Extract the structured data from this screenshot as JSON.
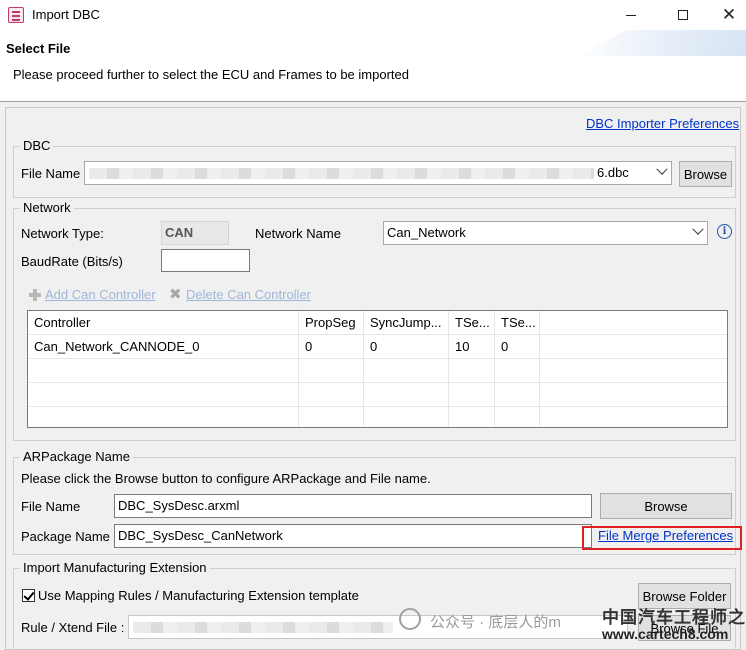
{
  "window": {
    "title": "Import DBC",
    "close_glyph": "✕"
  },
  "header": {
    "title": "Select File",
    "description": "Please proceed further to select the ECU and Frames to be imported"
  },
  "links": {
    "dbc_importer_preferences": "DBC Importer Preferences",
    "file_merge_preferences": "File Merge Preferences"
  },
  "dbc": {
    "legend": "DBC",
    "file_name_label": "File Name",
    "file_name_visible_suffix": "6.dbc",
    "browse_label": "Browse"
  },
  "network": {
    "legend": "Network",
    "type_label": "Network Type:",
    "type_value": "CAN",
    "name_label": "Network Name",
    "name_value": "Can_Network",
    "baudrate_label": "BaudRate (Bits/s)",
    "baudrate_value": "",
    "add_controller": "Add Can Controller",
    "delete_controller": "Delete Can Controller",
    "info_glyph": "i",
    "table": {
      "columns": [
        "Controller",
        "PropSeg",
        "SyncJump...",
        "TSe...",
        "TSe..."
      ],
      "rows": [
        [
          "Can_Network_CANNODE_0",
          "0",
          "0",
          "10",
          "0"
        ]
      ]
    }
  },
  "arpackage": {
    "legend": "ARPackage Name",
    "instruction": "Please click the Browse button to configure ARPackage and File name.",
    "file_name_label": "File Name",
    "file_name_value": "DBC_SysDesc.arxml",
    "browse_label": "Browse",
    "package_name_label": "Package Name",
    "package_name_value": "DBC_SysDesc_CanNetwork"
  },
  "manufacturing": {
    "legend": "Import Manufacturing Extension",
    "checkbox_label": "Use Mapping Rules / Manufacturing Extension template",
    "checkbox_checked": true,
    "browse_folder_label": "Browse Folder",
    "rule_label": "Rule / Xtend File :",
    "browse_file_label": "Browse File"
  },
  "watermark": {
    "text": "公众号 · 底层人的m",
    "logo": "中国汽车工程师之家",
    "url": "www.cartech8.com"
  },
  "colors": {
    "link": "#0033cc",
    "highlight": "#e02020",
    "disabled_link": "#9eb6d8"
  }
}
